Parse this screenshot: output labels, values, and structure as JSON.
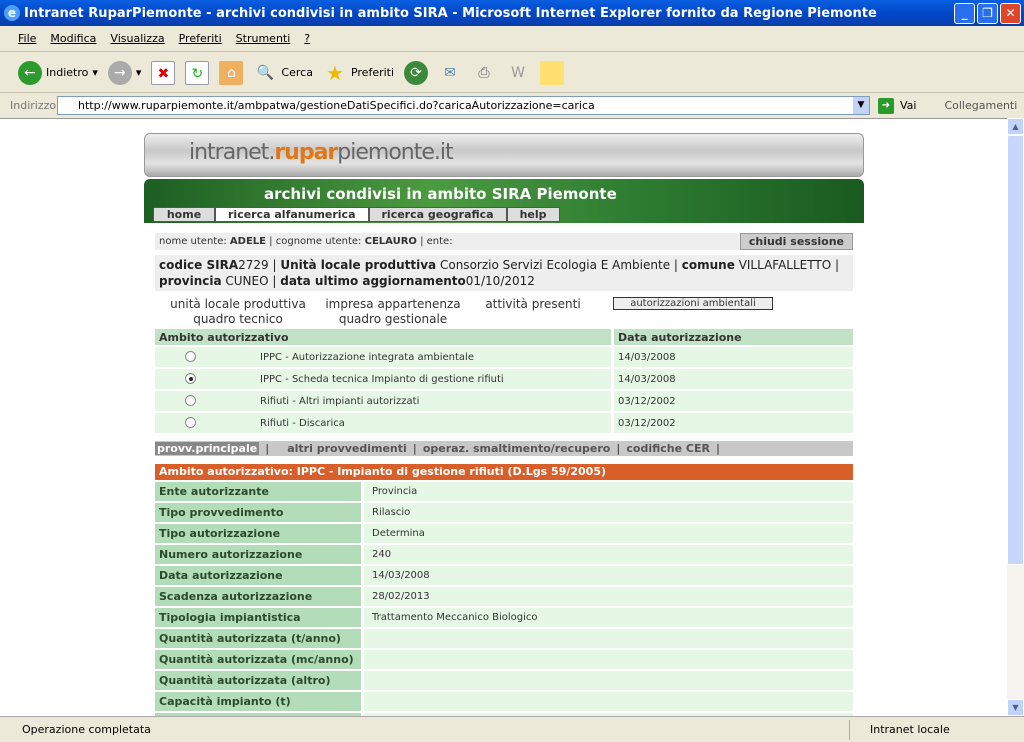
{
  "window": {
    "title": "Intranet RuparPiemonte - archivi condivisi in ambito SIRA - Microsoft Internet Explorer fornito da Regione Piemonte"
  },
  "menu": [
    "File",
    "Modifica",
    "Visualizza",
    "Preferiti",
    "Strumenti",
    "?"
  ],
  "toolbar": {
    "back": "Indietro",
    "search": "Cerca",
    "favorites": "Preferiti"
  },
  "address": {
    "label": "Indirizzo",
    "url": "http://www.ruparpiemonte.it/ambpatwa/gestioneDatiSpecifici.do?caricaAutorizzazione=carica",
    "go": "Vai",
    "links": "Collegamenti"
  },
  "status": {
    "text": "Operazione completata",
    "zone": "Intranet locale"
  },
  "site": {
    "logo_pre": "intranet.",
    "logo_brand": "rupar",
    "logo_post": "piemonte.it",
    "subtitle": "archivi condivisi in ambito SIRA Piemonte",
    "tabs": [
      "home",
      "ricerca alfanumerica",
      "ricerca geografica",
      "help"
    ],
    "user": {
      "name_label": "nome utente:",
      "name": "ADELE",
      "surname_label": "cognome utente:",
      "surname": "CELAURO",
      "ente_label": "ente:",
      "logout": "chiudi sessione"
    },
    "info": {
      "codice_label": "codice SIRA",
      "codice": "2729",
      "unita_label": "Unità locale produttiva",
      "unita": "Consorzio Servizi Ecologia E Ambiente",
      "comune_label": "comune",
      "comune": "VILLAFALLETTO",
      "provincia_label": "provincia",
      "provincia": "CUNEO",
      "data_label": "data ultimo aggiornamento",
      "data": "01/10/2012"
    },
    "subnav": [
      "unità locale produttiva",
      "impresa appartenenza",
      "attività presenti",
      "autorizzazioni ambientali",
      "quadro tecnico",
      "quadro gestionale"
    ],
    "ambiti": {
      "headers": [
        "Ambito autorizzativo",
        "Data autorizzazione"
      ],
      "rows": [
        {
          "label": "IPPC - Autorizzazione integrata ambientale",
          "date": "14/03/2008",
          "selected": false
        },
        {
          "label": "IPPC - Scheda tecnica Impianto di gestione rifiuti",
          "date": "14/03/2008",
          "selected": true
        },
        {
          "label": "Rifiuti - Altri impianti autorizzati",
          "date": "03/12/2002",
          "selected": false
        },
        {
          "label": "Rifiuti - Discarica",
          "date": "03/12/2002",
          "selected": false
        }
      ]
    },
    "ptabs": [
      "provv.principale",
      "altri provvedimenti",
      "operaz. smaltimento/recupero",
      "codifiche CER"
    ],
    "section_title": "Ambito autorizzativo: IPPC - Impianto di gestione rifiuti (D.Lgs 59/2005)",
    "details": [
      {
        "label": "Ente autorizzante",
        "value": "Provincia"
      },
      {
        "label": "Tipo provvedimento",
        "value": "Rilascio"
      },
      {
        "label": "Tipo autorizzazione",
        "value": "Determina"
      },
      {
        "label": "Numero autorizzazione",
        "value": "240"
      },
      {
        "label": "Data autorizzazione",
        "value": "14/03/2008"
      },
      {
        "label": "Scadenza autorizzazione",
        "value": "28/02/2013"
      },
      {
        "label": "Tipologia impiantistica",
        "value": "Trattamento Meccanico Biologico"
      },
      {
        "label": "Quantità autorizzata (t/anno)",
        "value": ""
      },
      {
        "label": "Quantità autorizzata (mc/anno)",
        "value": ""
      },
      {
        "label": "Quantità autorizzata (altro)",
        "value": ""
      },
      {
        "label": "Capacità impianto (t)",
        "value": ""
      }
    ]
  },
  "colors": {
    "label_bg": "#b3dcb8",
    "value_bg": "#e6f7e6",
    "section": "#d95f2a",
    "brand": "#e07818"
  }
}
